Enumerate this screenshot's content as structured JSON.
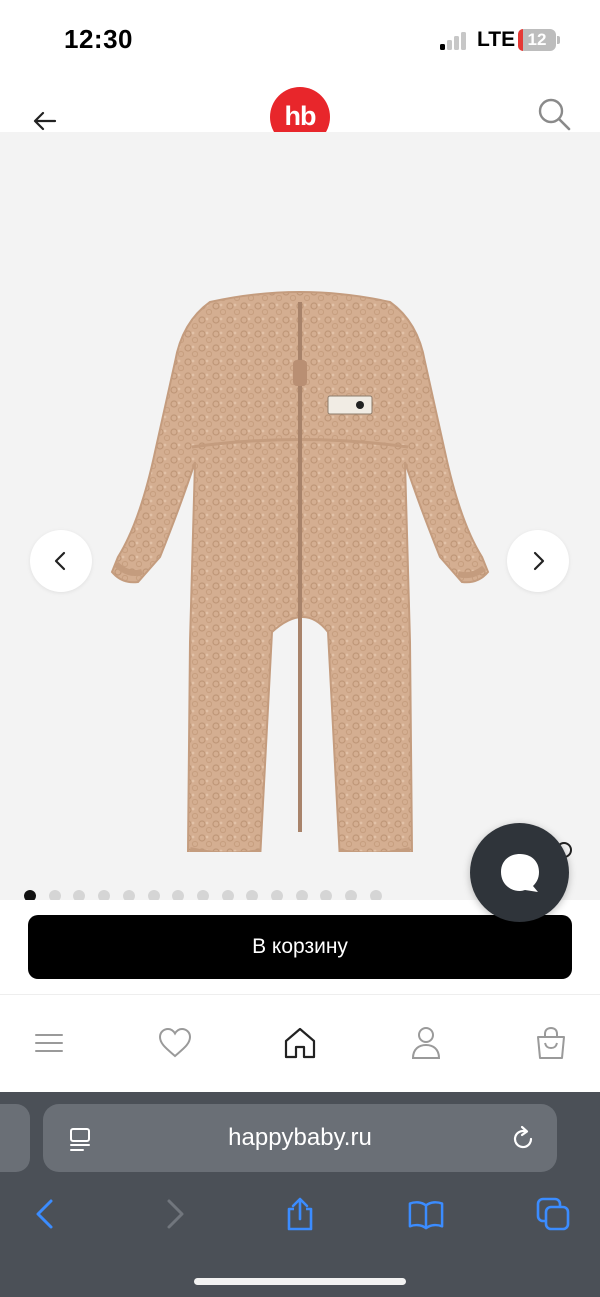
{
  "status_bar": {
    "time": "12:30",
    "network": "LTE",
    "battery_level": "12",
    "signal_bars_active": 1,
    "signal_bars_total": 4
  },
  "header": {
    "logo_text": "hb",
    "brand_color": "#e8262b",
    "back_icon": "arrow-left-icon",
    "search_icon": "search-icon"
  },
  "gallery": {
    "product_color": "#d4ae91",
    "image_count": 15,
    "active_index": 0,
    "prev_icon": "chevron-left-icon",
    "next_icon": "chevron-right-icon"
  },
  "chat": {
    "icon": "chat-bubble-icon"
  },
  "cart": {
    "button_label": "В корзину"
  },
  "bottom_nav": {
    "items": [
      {
        "icon": "menu-icon"
      },
      {
        "icon": "heart-icon"
      },
      {
        "icon": "home-icon"
      },
      {
        "icon": "user-icon"
      },
      {
        "icon": "shopping-bag-icon"
      }
    ]
  },
  "browser": {
    "url": "happybaby.ru",
    "accent": "#3b8cff"
  }
}
